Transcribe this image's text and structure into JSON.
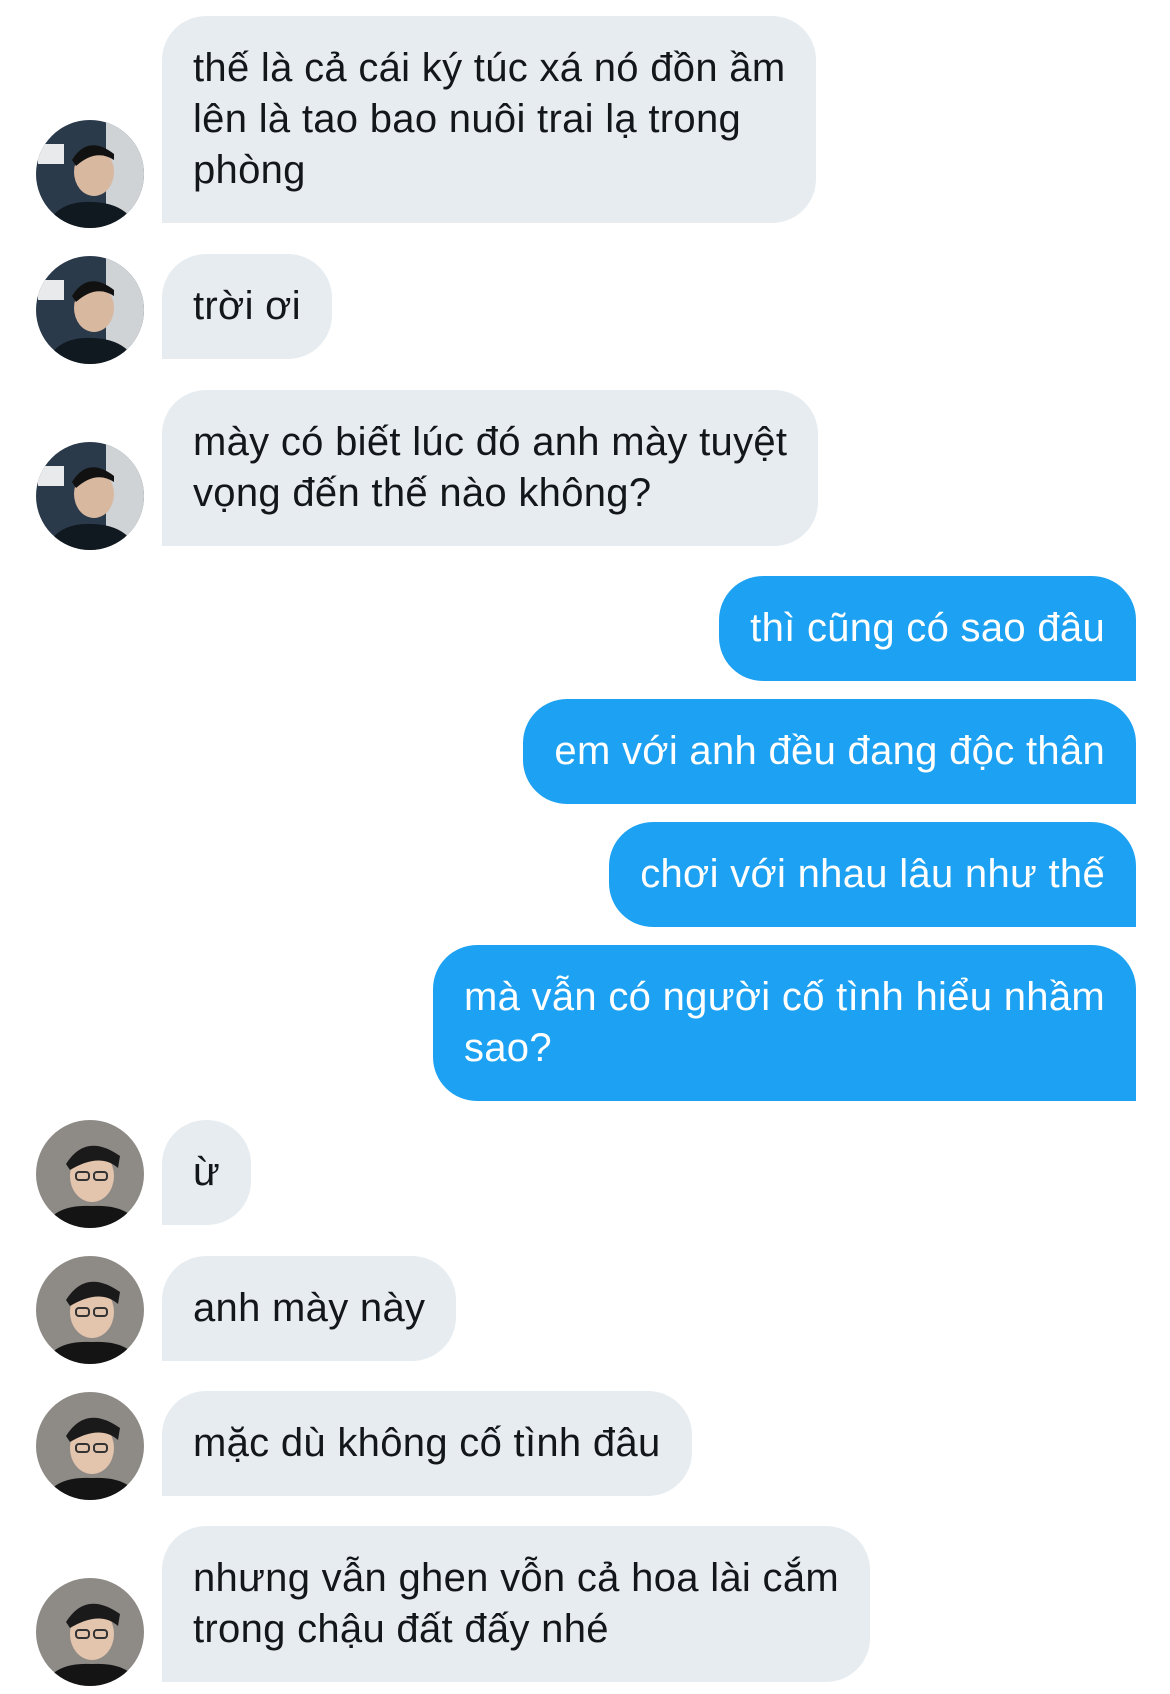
{
  "colors": {
    "incoming_bubble": "#e6ecf0",
    "outgoing_bubble": "#1da1f2",
    "incoming_text": "#14171a",
    "outgoing_text": "#ffffff"
  },
  "messages": [
    {
      "side": "in",
      "avatar": "avatar-a",
      "text": "thế là cả cái ký túc xá nó đồn ầm\nlên là tao bao nuôi trai lạ trong\nphòng"
    },
    {
      "side": "in",
      "avatar": "avatar-a",
      "text": "trời ơi"
    },
    {
      "side": "in",
      "avatar": "avatar-a",
      "text": "mày có biết lúc đó anh mày tuyệt\nvọng đến thế nào không?"
    },
    {
      "side": "out",
      "text": "thì cũng có sao đâu"
    },
    {
      "side": "out",
      "text": "em với anh đều đang độc thân"
    },
    {
      "side": "out",
      "text": "chơi với nhau lâu như thế"
    },
    {
      "side": "out",
      "text": "mà vẫn có người cố tình hiểu nhầm\nsao?"
    },
    {
      "side": "in",
      "avatar": "avatar-b",
      "text": "ừ"
    },
    {
      "side": "in",
      "avatar": "avatar-b",
      "text": "anh mày này"
    },
    {
      "side": "in",
      "avatar": "avatar-b",
      "text": "mặc dù không cố tình đâu"
    },
    {
      "side": "in",
      "avatar": "avatar-b",
      "text": "nhưng vẫn ghen vỗn cả hoa lài cắm\ntrong chậu đất đấy nhé"
    }
  ]
}
